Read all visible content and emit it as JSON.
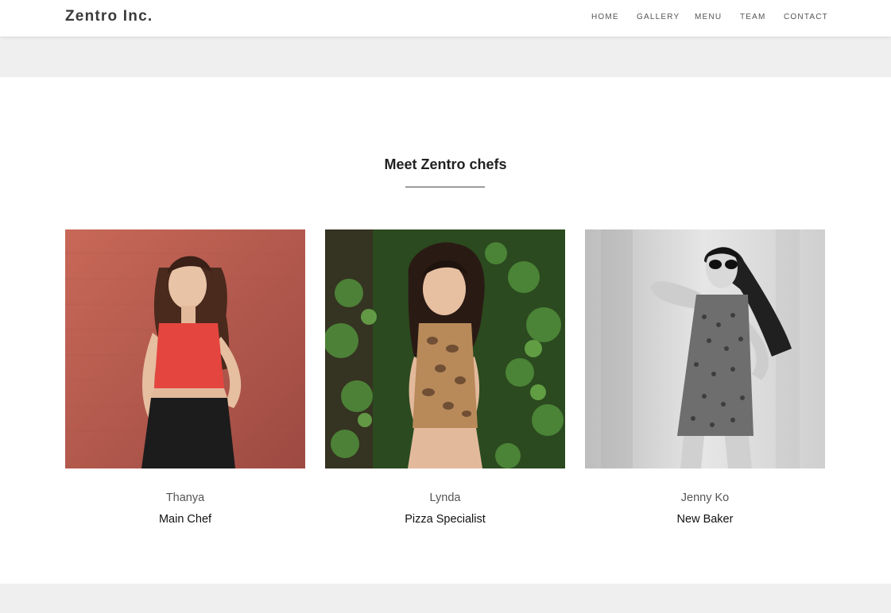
{
  "brand": "Zentro Inc.",
  "nav": [
    "HOME",
    "GALLERY",
    "MENU",
    "TEAM",
    "CONTACT"
  ],
  "section": {
    "title": "Meet Zentro chefs"
  },
  "chefs": [
    {
      "name": "Thanya",
      "role": "Main Chef",
      "photo_icon": "chef-photo-thanya"
    },
    {
      "name": "Lynda",
      "role": "Pizza Specialist",
      "photo_icon": "chef-photo-lynda"
    },
    {
      "name": "Jenny Ko",
      "role": "New Baker",
      "photo_icon": "chef-photo-jenny-ko"
    }
  ],
  "colors": {
    "band": "#efefef",
    "card1_bg": "#b5534a",
    "card1_top": "#c65f54",
    "card2_bg": "#2f5a24",
    "card3_bg": "#d9d9d9"
  }
}
